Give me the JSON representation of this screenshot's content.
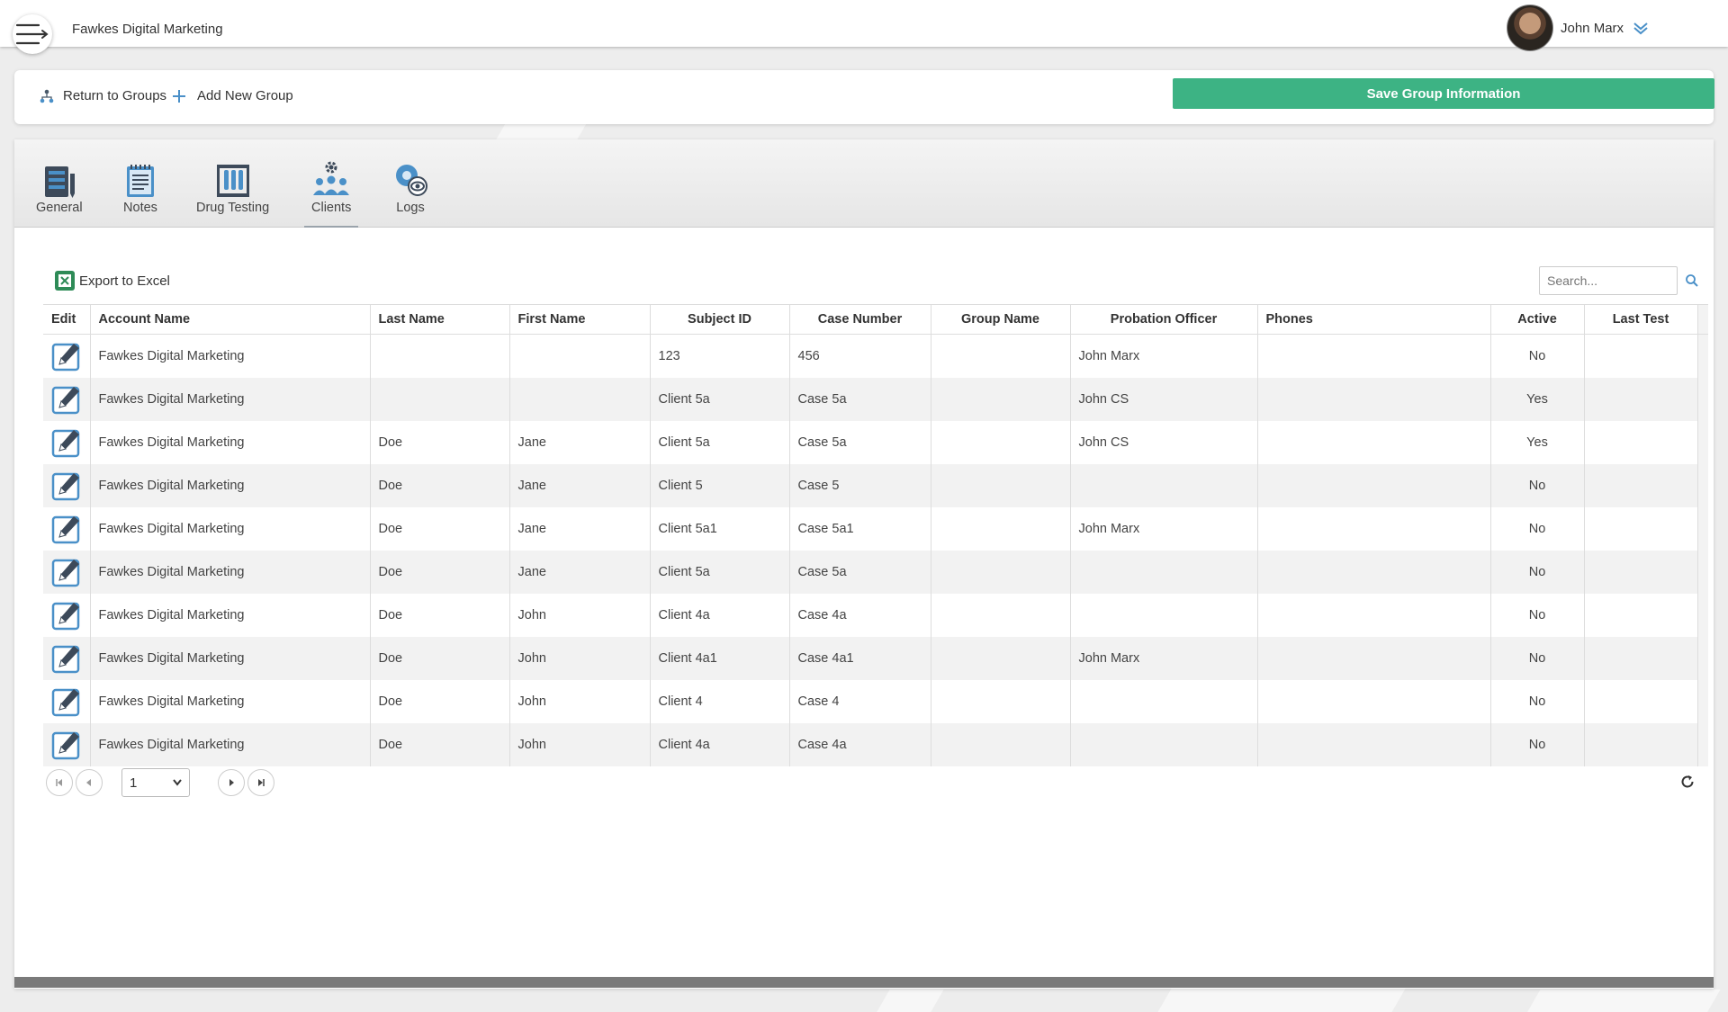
{
  "header": {
    "app_title": "Fawkes Digital Marketing",
    "user_name": "John Marx"
  },
  "toolbar": {
    "return_label": "Return to Groups",
    "add_label": "Add New Group",
    "save_label": "Save Group Information"
  },
  "tabs": [
    {
      "label": "General",
      "icon": "general-icon"
    },
    {
      "label": "Notes",
      "icon": "notes-icon"
    },
    {
      "label": "Drug Testing",
      "icon": "drug-testing-icon"
    },
    {
      "label": "Clients",
      "icon": "clients-icon",
      "active": true
    },
    {
      "label": "Logs",
      "icon": "logs-icon"
    }
  ],
  "grid": {
    "export_label": "Export to Excel",
    "search_placeholder": "Search...",
    "columns": [
      "Edit",
      "Account Name",
      "Last Name",
      "First Name",
      "Subject ID",
      "Case Number",
      "Group Name",
      "Probation Officer",
      "Phones",
      "Active",
      "Last Test"
    ],
    "rows": [
      {
        "account": "Fawkes Digital Marketing",
        "last": "",
        "first": "",
        "subject": "123",
        "case": "456",
        "group": "",
        "officer": "John Marx",
        "phones": "",
        "active": "No",
        "last_test": ""
      },
      {
        "account": "Fawkes Digital Marketing",
        "last": "",
        "first": "",
        "subject": "Client 5a",
        "case": "Case 5a",
        "group": "",
        "officer": "John CS",
        "phones": "",
        "active": "Yes",
        "last_test": ""
      },
      {
        "account": "Fawkes Digital Marketing",
        "last": "Doe",
        "first": "Jane",
        "subject": "Client 5a",
        "case": "Case 5a",
        "group": "",
        "officer": "John CS",
        "phones": "",
        "active": "Yes",
        "last_test": ""
      },
      {
        "account": "Fawkes Digital Marketing",
        "last": "Doe",
        "first": "Jane",
        "subject": "Client 5",
        "case": "Case 5",
        "group": "",
        "officer": "",
        "phones": "",
        "active": "No",
        "last_test": ""
      },
      {
        "account": "Fawkes Digital Marketing",
        "last": "Doe",
        "first": "Jane",
        "subject": "Client 5a1",
        "case": "Case 5a1",
        "group": "",
        "officer": "John Marx",
        "phones": "",
        "active": "No",
        "last_test": ""
      },
      {
        "account": "Fawkes Digital Marketing",
        "last": "Doe",
        "first": "Jane",
        "subject": "Client 5a",
        "case": "Case 5a",
        "group": "",
        "officer": "",
        "phones": "",
        "active": "No",
        "last_test": ""
      },
      {
        "account": "Fawkes Digital Marketing",
        "last": "Doe",
        "first": "John",
        "subject": "Client 4a",
        "case": "Case 4a",
        "group": "",
        "officer": "",
        "phones": "",
        "active": "No",
        "last_test": ""
      },
      {
        "account": "Fawkes Digital Marketing",
        "last": "Doe",
        "first": "John",
        "subject": "Client 4a1",
        "case": "Case 4a1",
        "group": "",
        "officer": "John Marx",
        "phones": "",
        "active": "No",
        "last_test": ""
      },
      {
        "account": "Fawkes Digital Marketing",
        "last": "Doe",
        "first": "John",
        "subject": "Client 4",
        "case": "Case 4",
        "group": "",
        "officer": "",
        "phones": "",
        "active": "No",
        "last_test": ""
      },
      {
        "account": "Fawkes Digital Marketing",
        "last": "Doe",
        "first": "John",
        "subject": "Client 4a",
        "case": "Case 4a",
        "group": "",
        "officer": "",
        "phones": "",
        "active": "No",
        "last_test": ""
      }
    ]
  },
  "pager": {
    "page": "1"
  },
  "colors": {
    "accent": "#3db384",
    "icon_blue": "#4a90c8"
  }
}
